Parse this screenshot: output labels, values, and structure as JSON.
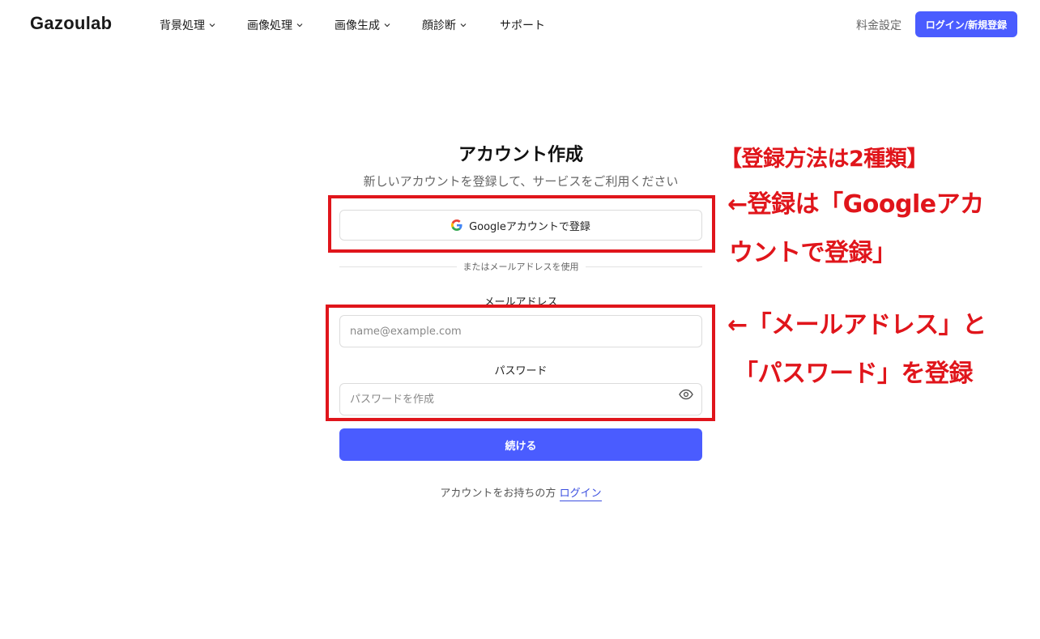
{
  "header": {
    "logo": "Gazoulab",
    "nav": [
      {
        "label": "背景処理"
      },
      {
        "label": "画像処理"
      },
      {
        "label": "画像生成"
      },
      {
        "label": "顔診断"
      },
      {
        "label": "サポート"
      }
    ],
    "pricing": "料金設定",
    "login_button": "ログイン/新規登録"
  },
  "form": {
    "title": "アカウント作成",
    "subtitle": "新しいアカウントを登録して、サービスをご利用ください",
    "google_button": "Googleアカウントで登録",
    "divider": "またはメールアドレスを使用",
    "email_label": "メールアドレス",
    "email_placeholder": "name@example.com",
    "email_value": "",
    "password_label": "パスワード",
    "password_placeholder": "パスワードを作成",
    "password_value": "",
    "continue_button": "続ける",
    "footer_text": "アカウントをお持ちの方",
    "footer_link": "ログイン"
  },
  "annotations": {
    "heading": "【登録方法は2種類】",
    "google_line1": "←登録は「Googleアカ",
    "google_line2": "ウントで登録」",
    "email_line1": "←「メールアドレス」と",
    "email_line2": "「パスワード」を登録"
  },
  "colors": {
    "accent": "#4a5cff",
    "annotation": "#e0151b"
  }
}
